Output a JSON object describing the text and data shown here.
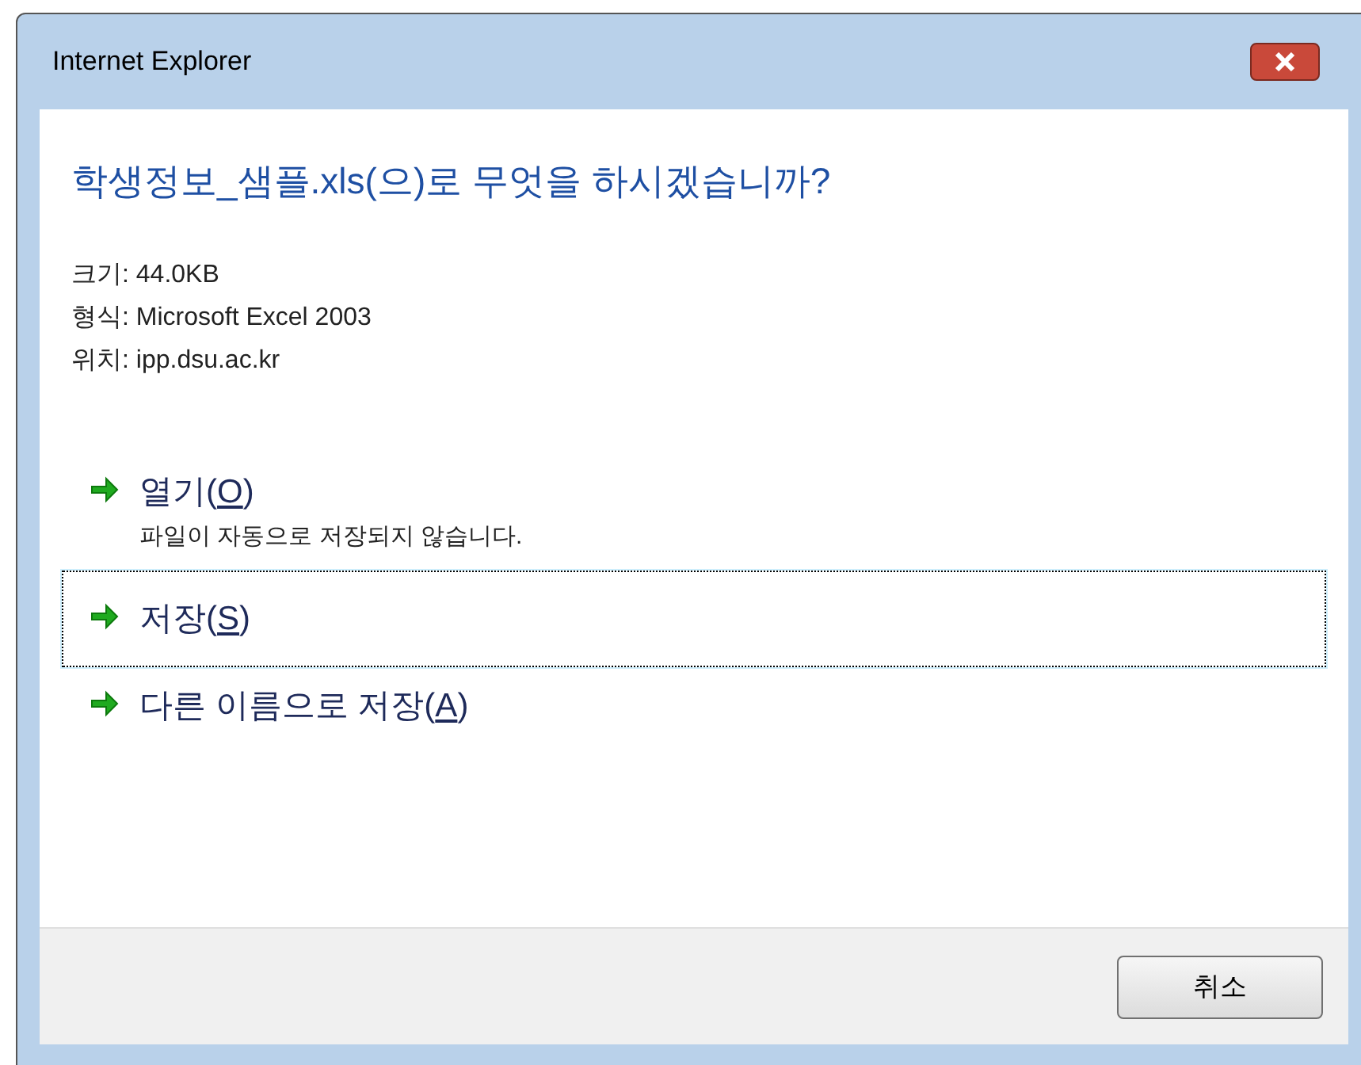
{
  "window": {
    "title": "Internet Explorer"
  },
  "heading": "학생정보_샘플.xls(으)로 무엇을 하시겠습니까?",
  "info": [
    "크기: 44.0KB",
    "형식: Microsoft Excel 2003",
    "위치: ipp.dsu.ac.kr"
  ],
  "options": [
    {
      "before": "열기(",
      "key": "O",
      "after": ")",
      "description": "파일이 자동으로 저장되지 않습니다.",
      "selected": false
    },
    {
      "before": "저장(",
      "key": "S",
      "after": ")",
      "selected": true
    },
    {
      "before": "다른 이름으로 저장(",
      "key": "A",
      "after": ")",
      "selected": false
    }
  ],
  "buttons": [
    "취소"
  ]
}
